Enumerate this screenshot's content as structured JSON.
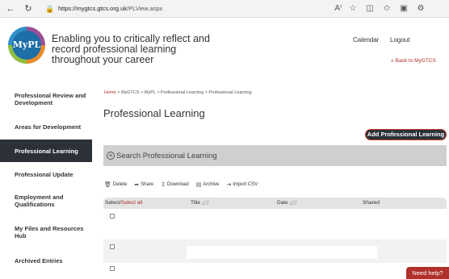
{
  "browser": {
    "url_host": "https://mygtcs.gtcs.org.uk",
    "url_path": "/PLView.aspx"
  },
  "header": {
    "logo_text": "MyPL",
    "tagline": "Enabling you to critically reflect and record professional learning throughout your career",
    "calendar_label": "Calendar",
    "logout_label": "Logout",
    "back_label": "Back to MyGTCS"
  },
  "sidebar": {
    "items": [
      {
        "label": "Professional Review and Development"
      },
      {
        "label": "Areas for Development"
      },
      {
        "label": "Professional Learning"
      },
      {
        "label": "Professional Update"
      },
      {
        "label": "Employment and Qualifications"
      },
      {
        "label": "My Files and Resources Hub"
      },
      {
        "label": "Archived Entries"
      }
    ]
  },
  "breadcrumb": {
    "home": "Home",
    "rest": " > MyGTCS > MyPL > Professional Learning > Professional Learning"
  },
  "page_title": "Professional Learning",
  "add_button_label": "Add Professional Learning",
  "search_label": "Search Professional Learning",
  "toolbar": {
    "delete": "Delete",
    "share": "Share",
    "download": "Download",
    "archive": "Archive",
    "import_csv": "Import CSV"
  },
  "table": {
    "select_label": "Select/",
    "select_all_label": "Select all",
    "col_title": "Title",
    "col_date": "Date",
    "col_shared": "Shared"
  },
  "help_label": "Need help?",
  "colors": {
    "accent_red": "#b0302a",
    "active_nav": "#2b3136",
    "search_bar": "#cfcfcf"
  }
}
